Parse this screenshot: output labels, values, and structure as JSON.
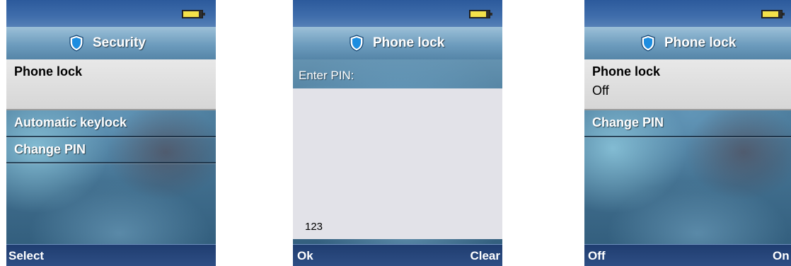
{
  "screens": [
    {
      "title": "Security",
      "menu": [
        {
          "label": "Phone lock",
          "selected": true
        },
        {
          "label": "Automatic keylock",
          "selected": false
        },
        {
          "label": "Change PIN",
          "selected": false
        }
      ],
      "softkeys": {
        "left": "Select",
        "right": ""
      }
    },
    {
      "title": "Phone lock",
      "prompt": "Enter PIN:",
      "pin_value": "123",
      "softkeys": {
        "left": "Ok",
        "right": "Clear"
      }
    },
    {
      "title": "Phone lock",
      "selected_item": {
        "label": "Phone lock",
        "value": "Off"
      },
      "menu": [
        {
          "label": "Change PIN",
          "selected": false
        }
      ],
      "softkeys": {
        "left": "Off",
        "right": "On"
      }
    }
  ],
  "icons": {
    "title": "shield-icon",
    "status": "battery-icon"
  },
  "colors": {
    "status_bar": "#2c5a9c",
    "soft_bar": "#1f3d70",
    "selected_item": "#d6d6d6",
    "shield": "#1d8de0",
    "battery": "#f4e24a"
  }
}
